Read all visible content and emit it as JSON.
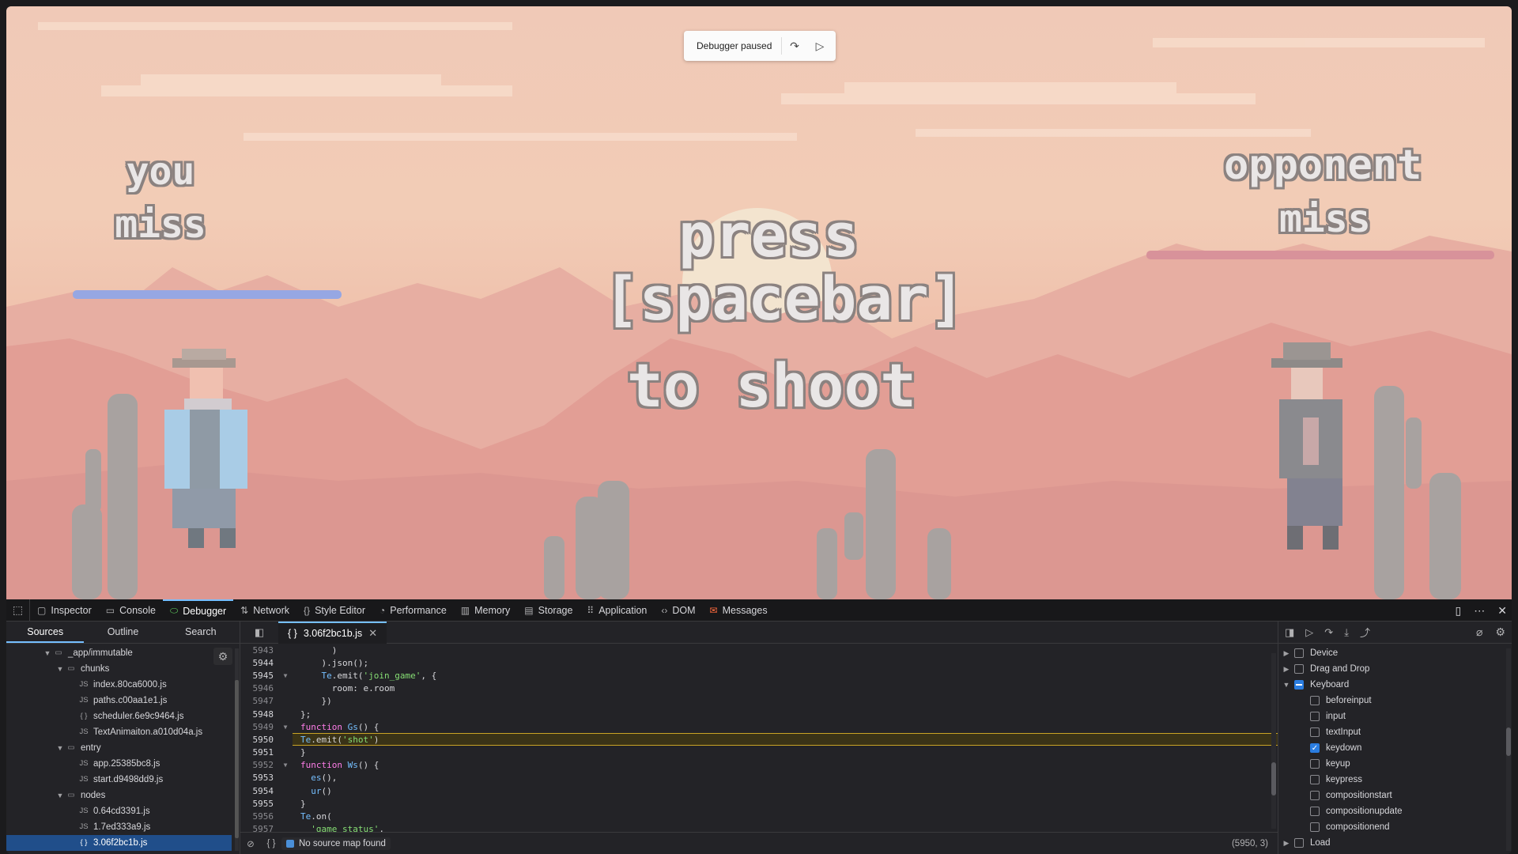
{
  "game": {
    "debugger_banner": {
      "label": "Debugger paused",
      "step_icon": "step-over-icon",
      "resume_icon": "resume-icon"
    },
    "you_label": "you",
    "you_status": "miss",
    "opponent_label": "opponent",
    "opponent_status": "miss",
    "prompt_line1": "press",
    "prompt_line2": "[spacebar]",
    "prompt_line3": "to shoot",
    "colors": {
      "you_bar": "#96a7e3",
      "opponent_bar": "#d8929a",
      "sky": "#f0c9b7"
    }
  },
  "devtools": {
    "tabs": [
      {
        "label": "Inspector",
        "icon": "inspector-icon"
      },
      {
        "label": "Console",
        "icon": "console-icon"
      },
      {
        "label": "Debugger",
        "icon": "debugger-icon",
        "active": true
      },
      {
        "label": "Network",
        "icon": "network-icon"
      },
      {
        "label": "Style Editor",
        "icon": "style-editor-icon"
      },
      {
        "label": "Performance",
        "icon": "performance-icon"
      },
      {
        "label": "Memory",
        "icon": "memory-icon"
      },
      {
        "label": "Storage",
        "icon": "storage-icon"
      },
      {
        "label": "Application",
        "icon": "application-icon"
      },
      {
        "label": "DOM",
        "icon": "dom-icon"
      },
      {
        "label": "Messages",
        "icon": "messages-icon"
      }
    ],
    "left_tabs": [
      "Sources",
      "Outline",
      "Search"
    ],
    "tree": [
      {
        "label": "_app/immutable",
        "type": "folder",
        "depth": 1,
        "open": true
      },
      {
        "label": "chunks",
        "type": "folder",
        "depth": 2,
        "open": true
      },
      {
        "label": "index.80ca6000.js",
        "type": "js",
        "depth": 3
      },
      {
        "label": "paths.c00aa1e1.js",
        "type": "js",
        "depth": 3
      },
      {
        "label": "scheduler.6e9c9464.js",
        "type": "braces",
        "depth": 3
      },
      {
        "label": "TextAnimaiton.a010d04a.js",
        "type": "js",
        "depth": 3
      },
      {
        "label": "entry",
        "type": "folder",
        "depth": 2,
        "open": true
      },
      {
        "label": "app.25385bc8.js",
        "type": "js",
        "depth": 3
      },
      {
        "label": "start.d9498dd9.js",
        "type": "js",
        "depth": 3
      },
      {
        "label": "nodes",
        "type": "folder",
        "depth": 2,
        "open": true
      },
      {
        "label": "0.64cd3391.js",
        "type": "js",
        "depth": 3
      },
      {
        "label": "1.7ed333a9.js",
        "type": "js",
        "depth": 3
      },
      {
        "label": "3.06f2bc1b.js",
        "type": "braces",
        "depth": 3,
        "selected": true
      }
    ],
    "editor_tab": "3.06f2bc1b.js",
    "code_lines": [
      {
        "n": "5943",
        "code": "      )"
      },
      {
        "n": "5944",
        "code": "    ).json();",
        "b": true
      },
      {
        "n": "5945",
        "code": "    Te.emit('join_game', {",
        "b": true,
        "fold": true
      },
      {
        "n": "5946",
        "code": "      room: e.room"
      },
      {
        "n": "5947",
        "code": "    })"
      },
      {
        "n": "5948",
        "code": "};",
        "b": true
      },
      {
        "n": "5949",
        "code": "function Gs() {",
        "fold": true
      },
      {
        "n": "5950",
        "code": "  Te.emit('shot')",
        "b": true,
        "hl": true
      },
      {
        "n": "5951",
        "code": "}",
        "b": true
      },
      {
        "n": "5952",
        "code": "function Ws() {",
        "fold": true
      },
      {
        "n": "5953",
        "code": "  es(),",
        "b": true
      },
      {
        "n": "5954",
        "code": "  ur()",
        "b": true
      },
      {
        "n": "5955",
        "code": "}",
        "b": true
      },
      {
        "n": "5956",
        "code": "Te.on("
      },
      {
        "n": "5957",
        "code": "  'game_status',"
      }
    ],
    "source_map_msg": "No source map found",
    "cursor_position": "(5950, 3)",
    "breakpoints": [
      {
        "label": "Device",
        "arrow": "▶",
        "state": "off"
      },
      {
        "label": "Drag and Drop",
        "arrow": "▶",
        "state": "off"
      },
      {
        "label": "Keyboard",
        "arrow": "▼",
        "state": "part"
      },
      {
        "label": "beforeinput",
        "child": true,
        "state": "off"
      },
      {
        "label": "input",
        "child": true,
        "state": "off"
      },
      {
        "label": "textInput",
        "child": true,
        "state": "off"
      },
      {
        "label": "keydown",
        "child": true,
        "state": "on"
      },
      {
        "label": "keyup",
        "child": true,
        "state": "off"
      },
      {
        "label": "keypress",
        "child": true,
        "state": "off"
      },
      {
        "label": "compositionstart",
        "child": true,
        "state": "off"
      },
      {
        "label": "compositionupdate",
        "child": true,
        "state": "off"
      },
      {
        "label": "compositionend",
        "child": true,
        "state": "off"
      },
      {
        "label": "Load",
        "arrow": "▶",
        "state": "off"
      }
    ]
  }
}
